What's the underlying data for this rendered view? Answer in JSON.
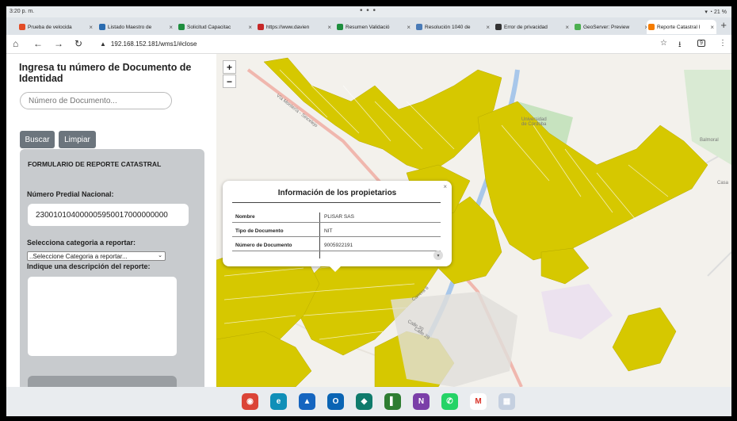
{
  "statusbar": {
    "time": "3:20 p. m.",
    "battery": "21 %"
  },
  "tabs": [
    {
      "label": "Prueba de velocida",
      "color": "#e34c26"
    },
    {
      "label": "Listado Maestro de",
      "color": "#2b6cb0"
    },
    {
      "label": "Solicitud Capacitac",
      "color": "#1e8e3e"
    },
    {
      "label": "https://www.davien",
      "color": "#c62828"
    },
    {
      "label": "Resumen Validació",
      "color": "#1e8e3e"
    },
    {
      "label": "Resolución 1040 de",
      "color": "#4a7bb7"
    },
    {
      "label": "Error de privacidad",
      "color": "#333333"
    },
    {
      "label": "GeoServer: Preview",
      "color": "#4caf50"
    },
    {
      "label": "Reporte Catastral I",
      "color": "#f57c00"
    }
  ],
  "address": {
    "url": "192.168.152.181/wms1/#close"
  },
  "sidebar": {
    "heading": "Ingresa tu número de Documento de Identidad",
    "doc_placeholder": "Número de Documento...",
    "search_label": "Buscar",
    "clear_label": "Limpiar",
    "form": {
      "title": "FORMULARIO DE REPORTE CATASTRAL",
      "predial_label": "Número Predial Nacional:",
      "predial_value": "230010104000005950017000000000",
      "category_label": "Selecciona categoria a reportar:",
      "category_selected": "..Seleccione Categoria a reportar...",
      "description_label": "Indique una descripción del reporte:"
    }
  },
  "map": {
    "zoom_in": "+",
    "zoom_out": "−",
    "labels": {
      "university": "Universidad de Córdoba",
      "balmoral": "Balmoral",
      "casa": "Casa",
      "street1": "Vía Montería - Sincelejo",
      "street2": "Carrera 6",
      "street3": "Calle 29",
      "street4": "Calle 30"
    }
  },
  "popup": {
    "title": "Información de los propietarios",
    "close": "×",
    "rows": [
      {
        "key": "Nombre",
        "value": "PLISAR SAS"
      },
      {
        "key": "Tipo de Documento",
        "value": "NIT"
      },
      {
        "key": "Número de Documento",
        "value": "9005922191"
      }
    ]
  },
  "colors": {
    "parcel": "#d6c800",
    "button": "#6c757d",
    "form_bg": "#c8cbce"
  },
  "dock": [
    {
      "name": "chrome-app",
      "color": "#db4437",
      "glyph": "◉"
    },
    {
      "name": "edge-app",
      "color": "#0f8fb8",
      "glyph": "e"
    },
    {
      "name": "photos-app",
      "color": "#1565c0",
      "glyph": "▲"
    },
    {
      "name": "outlook-app",
      "color": "#0a64b4",
      "glyph": "O"
    },
    {
      "name": "mobile-app",
      "color": "#0f7b6c",
      "glyph": "◆"
    },
    {
      "name": "planner-app",
      "color": "#2e7d32",
      "glyph": "▌"
    },
    {
      "name": "onenote-app",
      "color": "#7b3fa8",
      "glyph": "N"
    },
    {
      "name": "whatsapp-app",
      "color": "#25d366",
      "glyph": "✆"
    },
    {
      "name": "gmail-app",
      "color": "#ffffff",
      "glyph": "M"
    },
    {
      "name": "apps-grid",
      "color": "#c5d0e0",
      "glyph": "▦"
    }
  ]
}
